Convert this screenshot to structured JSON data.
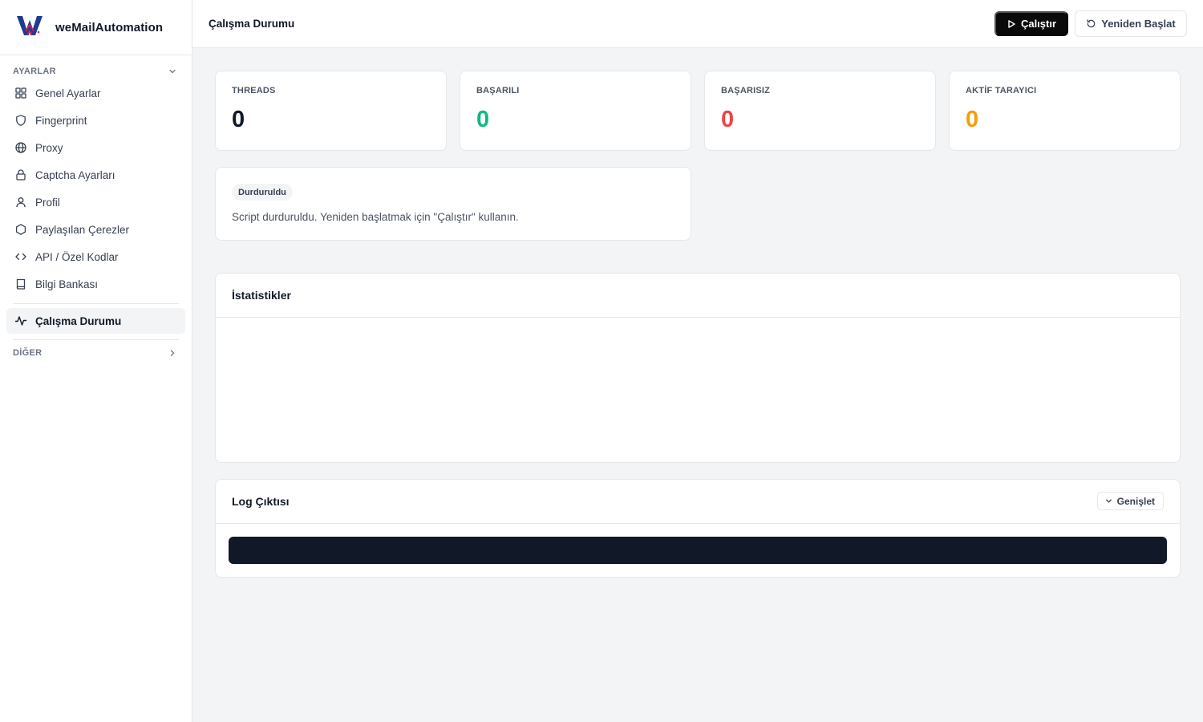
{
  "app": {
    "brand_name": "weMailAutomation",
    "logo_icon": "wm-logo-icon",
    "accent_color": "#1f3a93",
    "logo_red": "#e11d48"
  },
  "sidebar": {
    "settings_section": "AYARLAR",
    "other_section": "DİĞER",
    "items": [
      {
        "label": "Genel Ayarlar",
        "icon": "grid-icon"
      },
      {
        "label": "Fingerprint",
        "icon": "shield-icon"
      },
      {
        "label": "Proxy",
        "icon": "globe-icon"
      },
      {
        "label": "Captcha Ayarları",
        "icon": "lock-icon"
      },
      {
        "label": "Profil",
        "icon": "user-icon"
      },
      {
        "label": "Paylaşılan Çerezler",
        "icon": "hexagon-icon"
      },
      {
        "label": "API / Özel Kodlar",
        "icon": "code-icon"
      },
      {
        "label": "Bilgi Bankası",
        "icon": "book-icon"
      }
    ],
    "active_item": {
      "label": "Çalışma Durumu",
      "icon": "activity-icon"
    }
  },
  "header": {
    "title": "Çalışma Durumu",
    "run_label": "Çalıştır",
    "restart_label": "Yeniden Başlat"
  },
  "stats": [
    {
      "label": "THREADS",
      "value": "0",
      "color": "#111827"
    },
    {
      "label": "BAŞARILI",
      "value": "0",
      "color": "#10b981"
    },
    {
      "label": "BAŞARISIZ",
      "value": "0",
      "color": "#ef4444"
    },
    {
      "label": "AKTİF TARAYICI",
      "value": "0",
      "color": "#f59e0b"
    }
  ],
  "status": {
    "badge": "Durduruldu",
    "message": "Script durduruldu. Yeniden başlatmak için \"Çalıştır\" kullanın."
  },
  "statistics_panel": {
    "title": "İstatistikler"
  },
  "log_panel": {
    "title": "Log Çıktısı",
    "expand_label": "Genişlet",
    "console_color": "#111827"
  }
}
